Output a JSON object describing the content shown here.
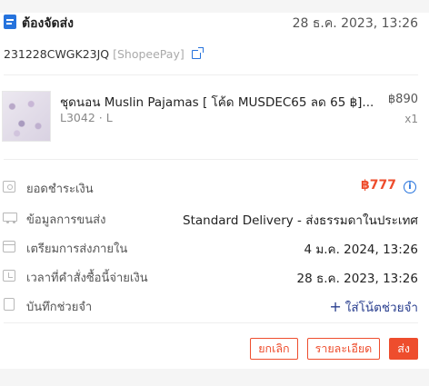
{
  "order": {
    "status": "ต้องจัดส่ง",
    "date": "28 ธ.ค. 2023, 13:26",
    "order_id": "231228CWGK23JQ",
    "payment_method": "[ShopeePay]",
    "copy_icon": "external-link-icon"
  },
  "product": {
    "title": "ชุดนอน Muslin Pajamas [ โค้ด MUSDEC65 ลด 65 ฿]...",
    "variant": "L3042 · L",
    "price": "฿890",
    "quantity": "x1"
  },
  "details": {
    "total": {
      "label": "ยอดชำระเงิน",
      "value": "฿777",
      "icon": "wallet-icon"
    },
    "shipping": {
      "label": "ข้อมูลการขนส่ง",
      "value": "Standard Delivery - ส่งธรรมดาในประเทศ",
      "icon": "truck-icon"
    },
    "ship_by": {
      "label": "เตรียมการส่งภายใน",
      "value": "4 ม.ค. 2024, 13:26",
      "icon": "calendar-icon"
    },
    "paid_time": {
      "label": "เวลาที่คำสั่งซื้อนี้จ่ายเงิน",
      "value": "28 ธ.ค. 2023, 13:26",
      "icon": "clock-icon"
    },
    "note": {
      "label": "บันทึกช่วยจำ",
      "value": "ใส่โน้ตช่วยจำ",
      "icon": "note-icon"
    }
  },
  "actions": {
    "cancel": "ยกเลิก",
    "details": "รายละเอียด",
    "ship": "ส่ง"
  },
  "colors": {
    "accent": "#ee4d2d",
    "link": "#2673dd",
    "note_link": "#2a3f8f"
  }
}
